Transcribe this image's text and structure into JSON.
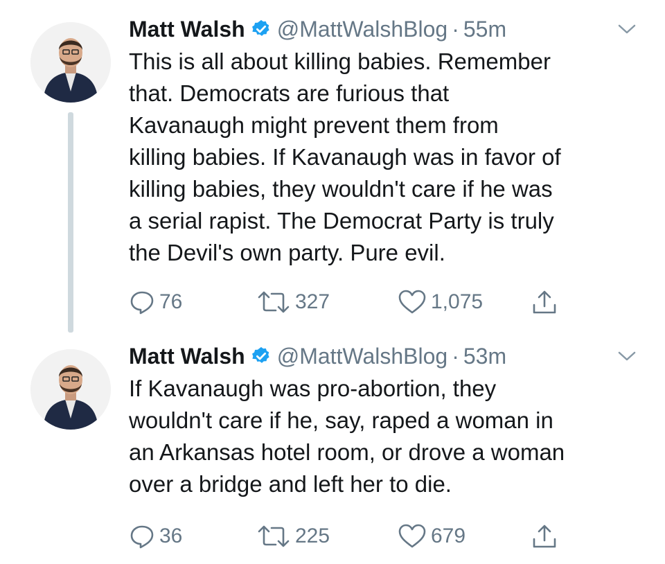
{
  "colors": {
    "text": "#14171a",
    "muted": "#657786",
    "verified": "#1da1f2",
    "thread_line": "#cfd9de"
  },
  "tweets": [
    {
      "author": {
        "name": "Matt Walsh",
        "verified_icon": "verified-badge-icon",
        "handle": "@MattWalshBlog",
        "separator": "·",
        "time": "55m"
      },
      "text": "This is all about killing babies. Remember\nthat. Democrats are furious that\nKavanaugh might prevent them from\nkilling babies. If Kavanaugh was in favor of\nkilling babies, they wouldn't care if he was\na serial rapist. The Democrat Party is truly\nthe Devil's own party. Pure evil.",
      "actions": {
        "replies": "76",
        "retweets": "327",
        "likes": "1,075"
      }
    },
    {
      "author": {
        "name": "Matt Walsh",
        "verified_icon": "verified-badge-icon",
        "handle": "@MattWalshBlog",
        "separator": "·",
        "time": "53m"
      },
      "text": "If Kavanaugh was pro-abortion, they\nwouldn't care if he, say, raped a woman in\nan Arkansas hotel room, or drove a woman\nover a bridge and left her to die.",
      "actions": {
        "replies": "36",
        "retweets": "225",
        "likes": "679"
      }
    }
  ]
}
